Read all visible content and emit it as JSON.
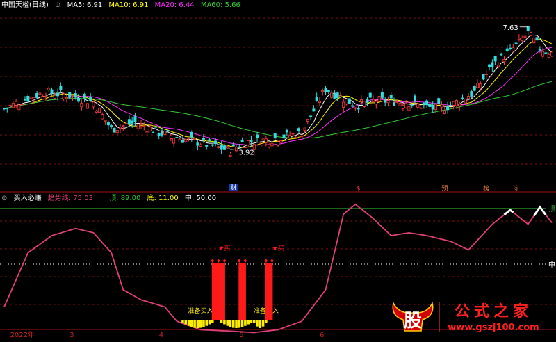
{
  "header1": {
    "title": "中国天楹(日线)",
    "ma": [
      {
        "label": "MA5: 6.91",
        "color": "#ffffff"
      },
      {
        "label": "MA10: 6.91",
        "color": "#ffff00"
      },
      {
        "label": "MA20: 6.44",
        "color": "#ff33ff"
      },
      {
        "label": "MA60: 5.66",
        "color": "#33cc33"
      }
    ]
  },
  "header2": {
    "title": "买入必赚",
    "trend": "趋势线: 75.03",
    "top": "顶: 89.00",
    "bottom": "底: 11.00",
    "mid": "中: 50.00"
  },
  "price_axis": {
    "min": 2.9,
    "max": 8.1
  },
  "markers": {
    "high_label": "7.63",
    "low_label": "3.92",
    "cai": "财",
    "tags": [
      {
        "text": "$",
        "color": "#ff4040",
        "day": 119
      },
      {
        "text": "预",
        "color": "#ff8a40",
        "day": 148
      },
      {
        "text": "榜",
        "color": "#ff8a40",
        "day": 162
      },
      {
        "text": "冻",
        "color": "#ff8a40",
        "day": 172
      }
    ]
  },
  "indicator": {
    "top_label": "顶",
    "mid_label": "中",
    "buy_label": "★买",
    "ready_label": "准备买入"
  },
  "x_axis": [
    "2022年",
    "3",
    "4",
    "5",
    "6"
  ],
  "watermark": {
    "logo": "股",
    "text": "公式之家",
    "url": "www.gszj100.com"
  },
  "colors": {
    "up": "#ff3b3b",
    "down": "#33dddd",
    "trend": "#e0407a",
    "signal": "#ff1a1a",
    "ready": "#ffee00"
  },
  "chart_data": [
    {
      "type": "candlestick",
      "title": "中国天楹(日线)",
      "series": [
        {
          "name": "MA5",
          "last": 6.91
        },
        {
          "name": "MA10",
          "last": 6.91
        },
        {
          "name": "MA20",
          "last": 6.44
        },
        {
          "name": "MA60",
          "last": 5.66
        }
      ],
      "annotations": [
        {
          "text": "7.63",
          "y": 7.63
        },
        {
          "text": "3.92",
          "y": 3.92
        }
      ],
      "x_ticks": [
        "2022年",
        "3",
        "4",
        "5",
        "6"
      ]
    },
    {
      "type": "line",
      "title": "买入必赚",
      "series": [
        {
          "name": "趋势线",
          "last": 75.03
        }
      ],
      "reference_lines": {
        "顶": 89,
        "底": 11,
        "中": 50
      },
      "ylim": [
        0,
        100
      ],
      "x_ticks": [
        "2022年",
        "3",
        "4",
        "5",
        "6"
      ]
    }
  ]
}
